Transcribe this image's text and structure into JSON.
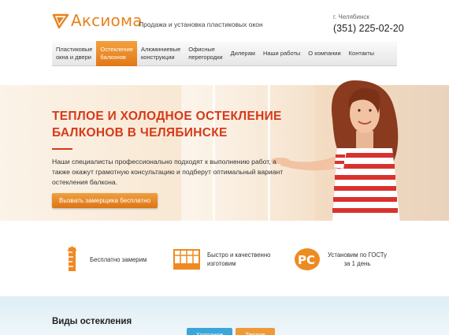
{
  "header": {
    "logo_text": "Аксиома",
    "tagline": "Продажа и установка пластиковых окон",
    "city": "г. Челябинск",
    "phone": "(351) 225-02-20"
  },
  "nav": {
    "items": [
      {
        "line1": "Пластиковые",
        "line2": "окна и двери"
      },
      {
        "line1": "Остекление",
        "line2": "балконов"
      },
      {
        "line1": "Алюминиевые",
        "line2": "конструкции"
      },
      {
        "line1": "Офисные",
        "line2": "перегородки"
      },
      {
        "line1": "Дилерам",
        "line2": ""
      },
      {
        "line1": "Наши работы",
        "line2": ""
      },
      {
        "line1": "О компании",
        "line2": ""
      },
      {
        "line1": "Контакты",
        "line2": ""
      }
    ]
  },
  "hero": {
    "title_line1": "ТЕПЛОЕ И ХОЛОДНОЕ ОСТЕКЛЕНИЕ",
    "title_line2": "БАЛКОНОВ В ЧЕЛЯБИНСКЕ",
    "text": "Наши специалисты профессионально подходят к выполнению работ, а также окажут грамотную консультацию и подберут оптимальный вариант остекления балкона.",
    "button_label": "Вызвать замерщика бесплатно"
  },
  "features": [
    {
      "icon": "ruler-icon",
      "line1": "Бесплатно замерим",
      "line2": ""
    },
    {
      "icon": "window-frame-icon",
      "line1": "Быстро и качественно",
      "line2": "изготовим"
    },
    {
      "icon": "rst-certificate-icon",
      "line1": "Установим по ГОСТу",
      "line2": "за 1 день"
    }
  ],
  "types": {
    "title": "Виды остекления",
    "tab_cold": "Холодное",
    "tab_warm": "Теплое"
  },
  "colors": {
    "accent": "#e8821f",
    "title_red": "#d6391a",
    "tab_blue": "#3aa6d9"
  }
}
